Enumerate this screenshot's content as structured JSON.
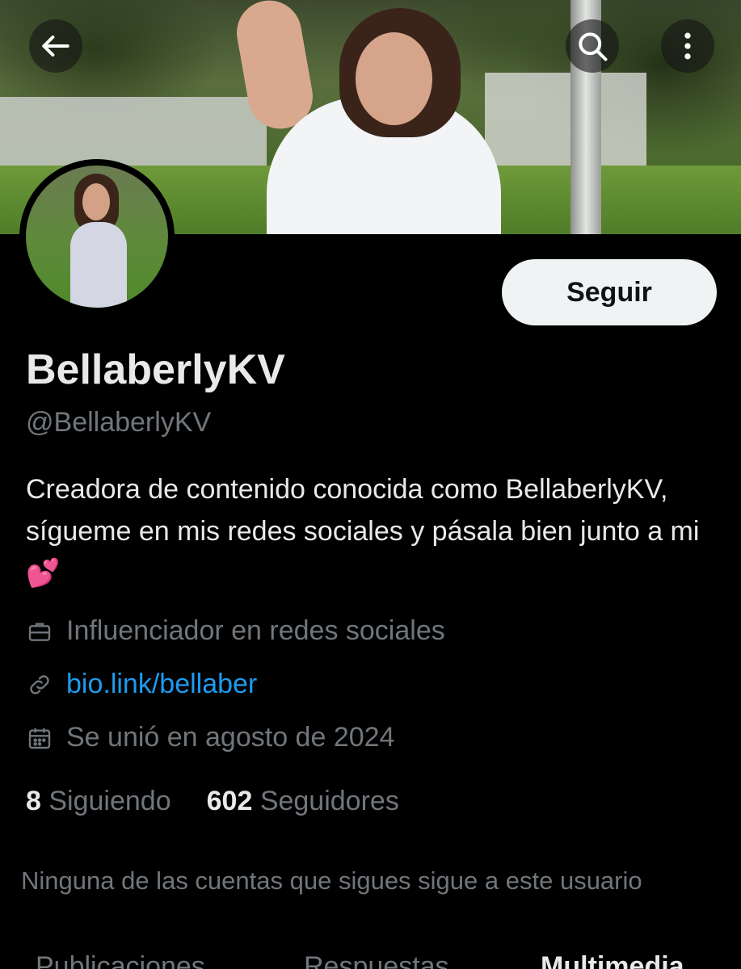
{
  "header": {
    "back_icon": "arrow-left-icon",
    "search_icon": "search-icon",
    "more_icon": "more-vertical-icon"
  },
  "profile": {
    "follow_label": "Seguir",
    "display_name": "BellaberlyKV",
    "handle": "@BellaberlyKV",
    "bio": "Creadora de contenido conocida como BellaberlyKV, sígueme en mis redes sociales y pásala bien junto a mi 💕",
    "job": "Influenciador en redes sociales",
    "link": "bio.link/bellaber",
    "joined": "Se unió en agosto de 2024"
  },
  "stats": {
    "following_count": "8",
    "following_label": "Siguiendo",
    "followers_count": "602",
    "followers_label": "Seguidores"
  },
  "mutual_text": "Ninguna de las cuentas que sigues sigue a este usuario",
  "tabs": [
    {
      "label": "Publicaciones"
    },
    {
      "label": "Respuestas"
    },
    {
      "label": "Multimedia"
    }
  ],
  "colors": {
    "background": "#000000",
    "link": "#1d9bf0",
    "muted": "#71767b",
    "text": "#e7e9ea"
  }
}
